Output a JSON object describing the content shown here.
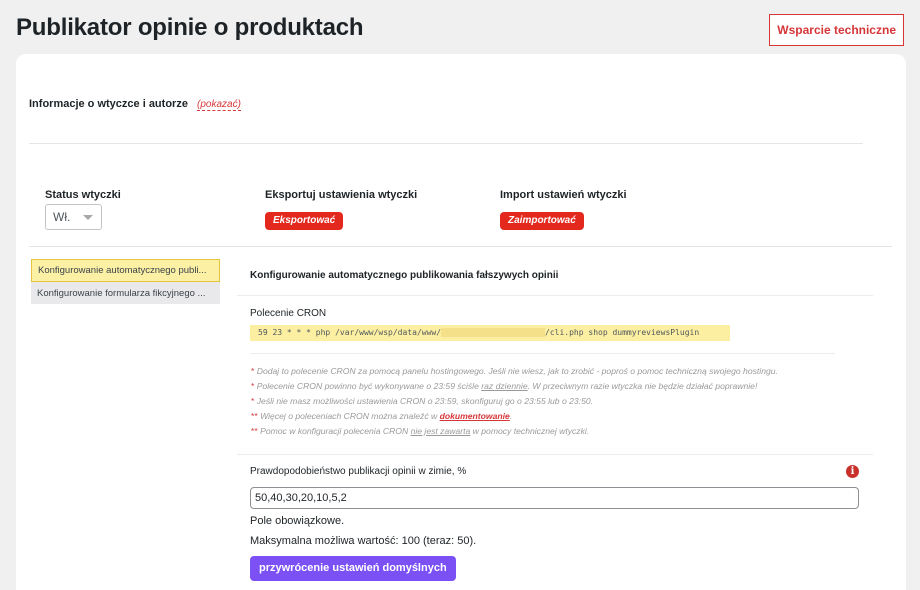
{
  "header": {
    "title": "Publikator opinie o produktach",
    "support_label": "Wsparcie techniczne"
  },
  "info": {
    "label": "Informacje o wtyczce i autorze",
    "show_link": "(pokazać)"
  },
  "status": {
    "label": "Status wtyczki",
    "value": "Wł."
  },
  "export": {
    "label": "Eksportuj ustawienia wtyczki",
    "button": "Eksportować"
  },
  "import": {
    "label": "Import ustawień wtyczki",
    "button": "Zaimportować"
  },
  "sidebar": {
    "items": [
      {
        "label": "Konfigurowanie automatycznego publi..."
      },
      {
        "label": "Konfigurowanie formularza fikcyjnego ..."
      }
    ]
  },
  "section": {
    "title": "Konfigurowanie automatycznego publikowania fałszywych opinii",
    "cron_label": "Polecenie CRON",
    "cron_prefix": "59 23 * * * php /var/www/wsp/data/www/",
    "cron_suffix": "/cli.php shop dummyreviewsPlugin"
  },
  "notes": {
    "n1": "Dodaj to polecenie CRON za pomocą panelu hostingowego. Jeśli nie wiesz, jak to zrobić - poproś o pomoc techniczną swojego hostingu.",
    "n2a": "Polecenie CRON powinno być wykonywane o 23:59 ściśle ",
    "n2b": "raz dziennie",
    "n2c": ". W przeciwnym razie wtyczka nie będzie działać poprawnie!",
    "n3": "Jeśli nie masz możliwości ustawienia CRON o 23:59, skonfiguruj go o 23:55 lub o 23:50.",
    "n4a": "Więcej o poleceniach CRON można znaleźć w ",
    "n4b": "dokumentowanie",
    "n4c": ".",
    "n5a": "Pomoc w konfiguracji polecenia CRON ",
    "n5b": "nie jest zawarta",
    "n5c": " w pomocy technicznej wtyczki."
  },
  "probability": {
    "label": "Prawdopodobieństwo publikacji opinii w zimie, %",
    "value": "50,40,30,20,10,5,2",
    "help_required": "Pole obowiązkowe.",
    "help_max": "Maksymalna możliwa wartość: 100 (teraz: 50).",
    "restore_button": "przywrócenie ustawień domyślnych"
  },
  "colors": {
    "accent_red": "#e3281d",
    "accent_purple": "#7b50f5",
    "highlight_yellow": "#fcf0a5"
  }
}
